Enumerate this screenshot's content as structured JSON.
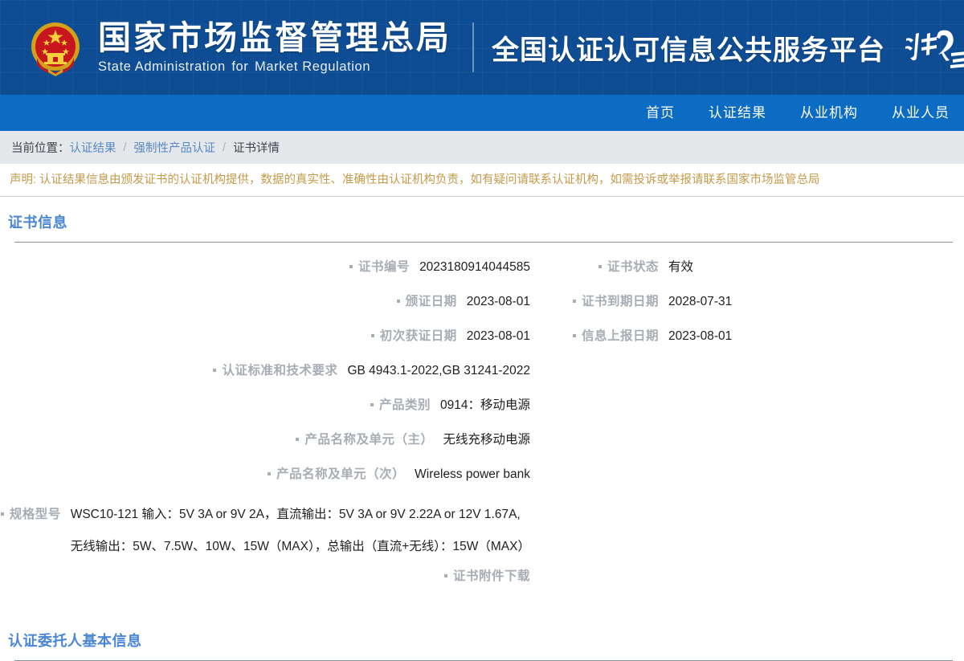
{
  "header": {
    "emblem_icon": "china-national-emblem",
    "org_name_cn": "国家市场监督管理总局",
    "org_name_en_1": "State Administration",
    "org_name_en_2": "for",
    "org_name_en_3": "Market Regulation",
    "platform_title": "全国认证认可信息公共服务平台",
    "cloud_logo_icon": "ren-yun-logo",
    "bg_color": "#0e4c93"
  },
  "nav": {
    "bg_color": "#0c6cc4",
    "items": [
      {
        "label": "首页",
        "name": "nav-home"
      },
      {
        "label": "认证结果",
        "name": "nav-certification-results"
      },
      {
        "label": "从业机构",
        "name": "nav-institutions"
      },
      {
        "label": "从业人员",
        "name": "nav-personnel"
      }
    ]
  },
  "breadcrumb": {
    "prefix": "当前位置：",
    "separator": "/",
    "items": [
      {
        "label": "认证结果",
        "link": true
      },
      {
        "label": "强制性产品认证",
        "link": true
      },
      {
        "label": "证书详情",
        "link": false
      }
    ]
  },
  "disclaimer": {
    "text": "声明: 认证结果信息由颁发证书的认证机构提供，数据的真实性、准确性由认证机构负责，如有疑问请联系认证机构，如需投诉或举报请联系国家市场监管总局",
    "color": "#c49a4a"
  },
  "cert_section": {
    "title": "证书信息",
    "title_color": "#4a86d6",
    "fields": {
      "cert_no_label": "证书编号",
      "cert_no_value": "2023180914044585",
      "cert_status_label": "证书状态",
      "cert_status_value": "有效",
      "issue_date_label": "颁证日期",
      "issue_date_value": "2023-08-01",
      "expiry_date_label": "证书到期日期",
      "expiry_date_value": "2028-07-31",
      "first_cert_date_label": "初次获证日期",
      "first_cert_date_value": "2023-08-01",
      "report_date_label": "信息上报日期",
      "report_date_value": "2023-08-01",
      "standards_label": "认证标准和技术要求",
      "standards_value": "GB 4943.1-2022,GB 31241-2022",
      "product_category_label": "产品类别",
      "product_category_value": "0914：移动电源",
      "product_name_main_label": "产品名称及单元（主）",
      "product_name_main_value": "无线充移动电源",
      "product_name_sec_label": "产品名称及单元（次）",
      "product_name_sec_value": "Wireless power bank",
      "spec_model_label": "规格型号",
      "spec_model_line1": "WSC10-121 输入：5V 3A or 9V 2A，直流输出：5V 3A or 9V 2.22A or 12V 1.67A,",
      "spec_model_line2": "无线输出：5W、7.5W、10W、15W（MAX），总输出（直流+无线）：15W（MAX）",
      "attachment_label": "证书附件下载"
    }
  },
  "client_section": {
    "title": "认证委托人基本信息",
    "title_color": "#4a86d6"
  }
}
